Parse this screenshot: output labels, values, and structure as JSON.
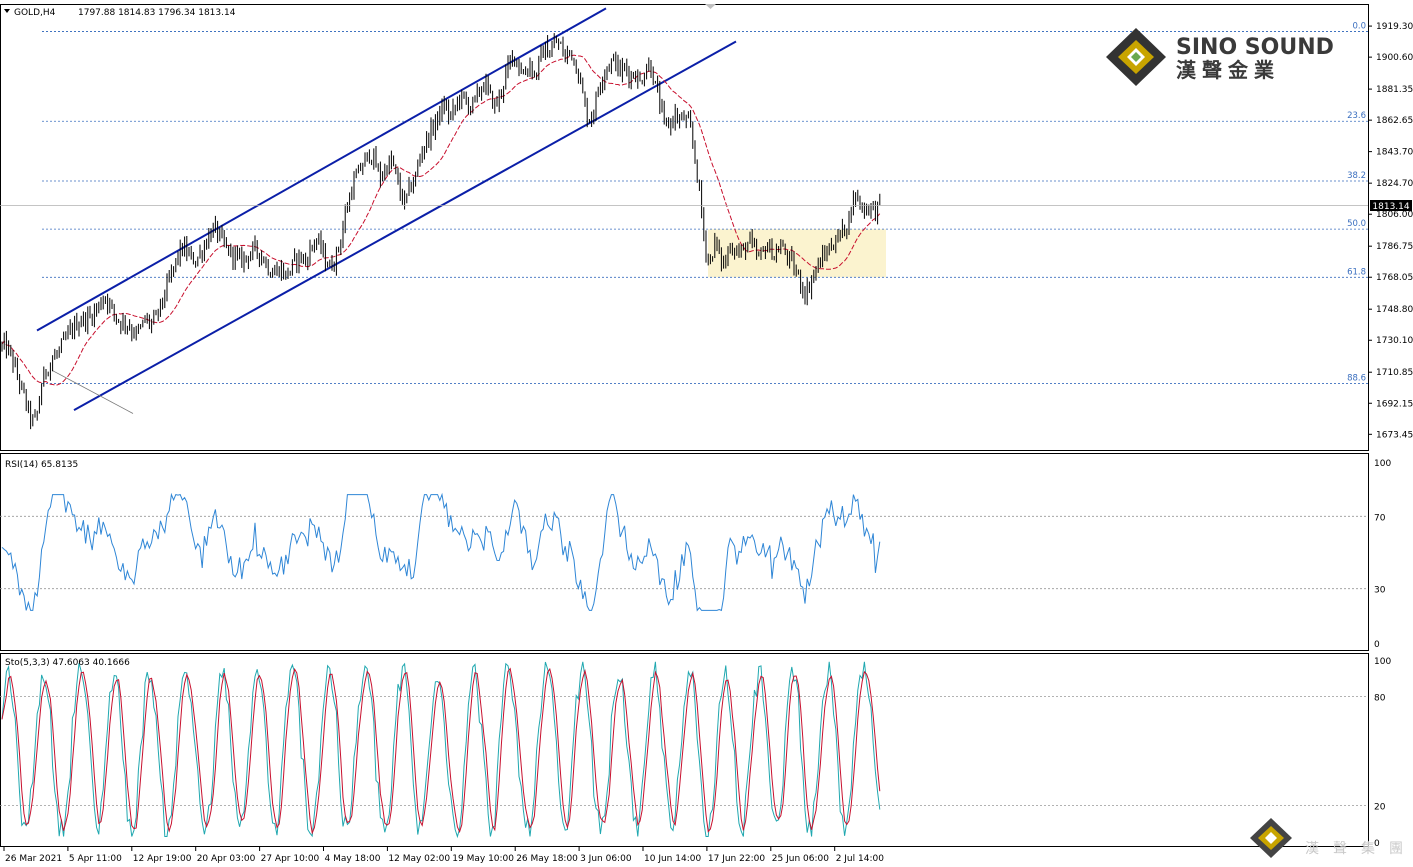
{
  "header": {
    "symbol": "GOLD,H4",
    "ohlc": "1797.88 1814.83 1796.34 1813.14"
  },
  "logo": {
    "brand_en": "SINO SOUND",
    "brand_cn": "漢聲金業"
  },
  "watermark": {
    "text_cn": "漢聲集團"
  },
  "colors": {
    "channel": "#0b1fa8",
    "ma": "#c8102e",
    "fib": "#3b6fbf",
    "rsi": "#2f86d6",
    "sto_main": "#20a8b0",
    "sto_signal": "#c8102e",
    "zone": "#fbf3cf",
    "price_tag_bg": "#000000"
  },
  "chart_data": {
    "type": "candlestick",
    "symbol": "GOLD",
    "timeframe": "H4",
    "price_axis": {
      "range": [
        1664,
        1932
      ],
      "ticks": [
        "1919.30",
        "1900.60",
        "1881.35",
        "1862.65",
        "1843.70",
        "1824.70",
        "1806.00",
        "1786.75",
        "1768.05",
        "1748.80",
        "1730.10",
        "1710.85",
        "1692.15",
        "1673.45"
      ]
    },
    "current_price": "1813.14",
    "time_axis": [
      "26 Mar 2021",
      "5 Apr 11:00",
      "12 Apr 19:00",
      "20 Apr 03:00",
      "27 Apr 10:00",
      "4 May 18:00",
      "12 May 02:00",
      "19 May 10:00",
      "26 May 18:00",
      "3 Jun 06:00",
      "10 Jun 14:00",
      "17 Jun 22:00",
      "25 Jun 06:00",
      "2 Jul 14:00"
    ],
    "fibonacci": [
      {
        "level": "0.0",
        "price": 1916
      },
      {
        "level": "23.6",
        "price": 1862
      },
      {
        "level": "38.2",
        "price": 1826
      },
      {
        "level": "50.0",
        "price": 1797
      },
      {
        "level": "61.8",
        "price": 1768
      },
      {
        "level": "88.6",
        "price": 1704
      }
    ],
    "price_path": [
      [
        0,
        1726
      ],
      [
        5,
        1727
      ],
      [
        10,
        1722
      ],
      [
        14,
        1715
      ],
      [
        18,
        1707
      ],
      [
        22,
        1700
      ],
      [
        26,
        1692
      ],
      [
        30,
        1684
      ],
      [
        34,
        1680
      ],
      [
        38,
        1688
      ],
      [
        42,
        1705
      ],
      [
        46,
        1712
      ],
      [
        50,
        1716
      ],
      [
        54,
        1720
      ],
      [
        58,
        1722
      ],
      [
        62,
        1727
      ],
      [
        66,
        1731
      ],
      [
        70,
        1735
      ],
      [
        75,
        1739
      ],
      [
        80,
        1742
      ],
      [
        85,
        1743
      ],
      [
        90,
        1744
      ],
      [
        95,
        1748
      ],
      [
        100,
        1752
      ],
      [
        105,
        1757
      ],
      [
        110,
        1751
      ],
      [
        115,
        1745
      ],
      [
        120,
        1741
      ],
      [
        125,
        1741
      ],
      [
        130,
        1738
      ],
      [
        135,
        1734
      ],
      [
        140,
        1736
      ],
      [
        145,
        1743
      ],
      [
        150,
        1740
      ],
      [
        155,
        1742
      ],
      [
        160,
        1750
      ],
      [
        165,
        1758
      ],
      [
        170,
        1768
      ],
      [
        175,
        1776
      ],
      [
        180,
        1784
      ],
      [
        185,
        1785
      ],
      [
        190,
        1780
      ],
      [
        195,
        1778
      ],
      [
        200,
        1782
      ],
      [
        205,
        1788
      ],
      [
        210,
        1795
      ],
      [
        215,
        1797
      ],
      [
        220,
        1792
      ],
      [
        225,
        1786
      ],
      [
        230,
        1783
      ],
      [
        235,
        1781
      ],
      [
        240,
        1778
      ],
      [
        245,
        1780
      ],
      [
        250,
        1782
      ],
      [
        255,
        1785
      ],
      [
        260,
        1782
      ],
      [
        265,
        1778
      ],
      [
        270,
        1772
      ],
      [
        275,
        1771
      ],
      [
        280,
        1774
      ],
      [
        285,
        1769
      ],
      [
        290,
        1772
      ],
      [
        295,
        1778
      ],
      [
        300,
        1781
      ],
      [
        305,
        1777
      ],
      [
        310,
        1784
      ],
      [
        315,
        1791
      ],
      [
        320,
        1787
      ],
      [
        325,
        1779
      ],
      [
        330,
        1774
      ],
      [
        335,
        1779
      ],
      [
        340,
        1789
      ],
      [
        345,
        1805
      ],
      [
        350,
        1818
      ],
      [
        355,
        1827
      ],
      [
        360,
        1833
      ],
      [
        365,
        1838
      ],
      [
        370,
        1843
      ],
      [
        375,
        1837
      ],
      [
        380,
        1828
      ],
      [
        385,
        1833
      ],
      [
        390,
        1838
      ],
      [
        395,
        1833
      ],
      [
        400,
        1818
      ],
      [
        405,
        1813
      ],
      [
        410,
        1822
      ],
      [
        415,
        1827
      ],
      [
        420,
        1841
      ],
      [
        425,
        1849
      ],
      [
        430,
        1854
      ],
      [
        435,
        1861
      ],
      [
        440,
        1867
      ],
      [
        445,
        1872
      ],
      [
        450,
        1864
      ],
      [
        455,
        1870
      ],
      [
        460,
        1877
      ],
      [
        465,
        1874
      ],
      [
        470,
        1871
      ],
      [
        475,
        1874
      ],
      [
        480,
        1881
      ],
      [
        485,
        1885
      ],
      [
        490,
        1877
      ],
      [
        495,
        1871
      ],
      [
        500,
        1877
      ],
      [
        505,
        1889
      ],
      [
        510,
        1897
      ],
      [
        515,
        1902
      ],
      [
        520,
        1894
      ],
      [
        525,
        1890
      ],
      [
        530,
        1897
      ],
      [
        535,
        1888
      ],
      [
        540,
        1900
      ],
      [
        545,
        1906
      ],
      [
        550,
        1903
      ],
      [
        555,
        1910
      ],
      [
        560,
        1908
      ],
      [
        565,
        1900
      ],
      [
        570,
        1905
      ],
      [
        575,
        1898
      ],
      [
        580,
        1887
      ],
      [
        585,
        1870
      ],
      [
        590,
        1862
      ],
      [
        595,
        1872
      ],
      [
        600,
        1886
      ],
      [
        605,
        1893
      ],
      [
        610,
        1897
      ],
      [
        615,
        1899
      ],
      [
        620,
        1891
      ],
      [
        625,
        1895
      ],
      [
        630,
        1889
      ],
      [
        635,
        1891
      ],
      [
        640,
        1885
      ],
      [
        645,
        1893
      ],
      [
        650,
        1897
      ],
      [
        655,
        1884
      ],
      [
        660,
        1872
      ],
      [
        665,
        1858
      ],
      [
        670,
        1861
      ],
      [
        675,
        1866
      ],
      [
        680,
        1862
      ],
      [
        685,
        1864
      ],
      [
        690,
        1858
      ],
      [
        695,
        1840
      ],
      [
        700,
        1816
      ],
      [
        705,
        1786
      ],
      [
        710,
        1777
      ],
      [
        715,
        1790
      ],
      [
        720,
        1779
      ],
      [
        725,
        1776
      ],
      [
        730,
        1788
      ],
      [
        735,
        1785
      ],
      [
        740,
        1782
      ],
      [
        745,
        1786
      ],
      [
        750,
        1790
      ],
      [
        755,
        1782
      ],
      [
        760,
        1779
      ],
      [
        765,
        1787
      ],
      [
        770,
        1785
      ],
      [
        775,
        1781
      ],
      [
        780,
        1787
      ],
      [
        785,
        1783
      ],
      [
        790,
        1778
      ],
      [
        795,
        1772
      ],
      [
        800,
        1766
      ],
      [
        805,
        1758
      ],
      [
        810,
        1764
      ],
      [
        815,
        1772
      ],
      [
        820,
        1777
      ],
      [
        825,
        1782
      ],
      [
        830,
        1786
      ],
      [
        835,
        1790
      ],
      [
        840,
        1794
      ],
      [
        845,
        1797
      ],
      [
        850,
        1807
      ],
      [
        855,
        1818
      ],
      [
        860,
        1813
      ],
      [
        865,
        1808
      ],
      [
        870,
        1812
      ],
      [
        875,
        1807
      ],
      [
        880,
        1813
      ]
    ],
    "channel_upper": {
      "from": [
        37,
        1736
      ],
      "to": [
        606,
        1930
      ]
    },
    "channel_lower": {
      "from": [
        74,
        1688
      ],
      "to": [
        736,
        1910
      ]
    },
    "ma_note": "moving average overlay",
    "indicators": [
      {
        "name": "RSI(14)",
        "value": "65.8135",
        "levels": [
          "100",
          "70",
          "30",
          "0"
        ]
      },
      {
        "name": "Sto(5,3,3)",
        "values": [
          "47.6063",
          "40.1666"
        ],
        "levels": [
          "100",
          "80",
          "20",
          "0"
        ]
      }
    ]
  }
}
